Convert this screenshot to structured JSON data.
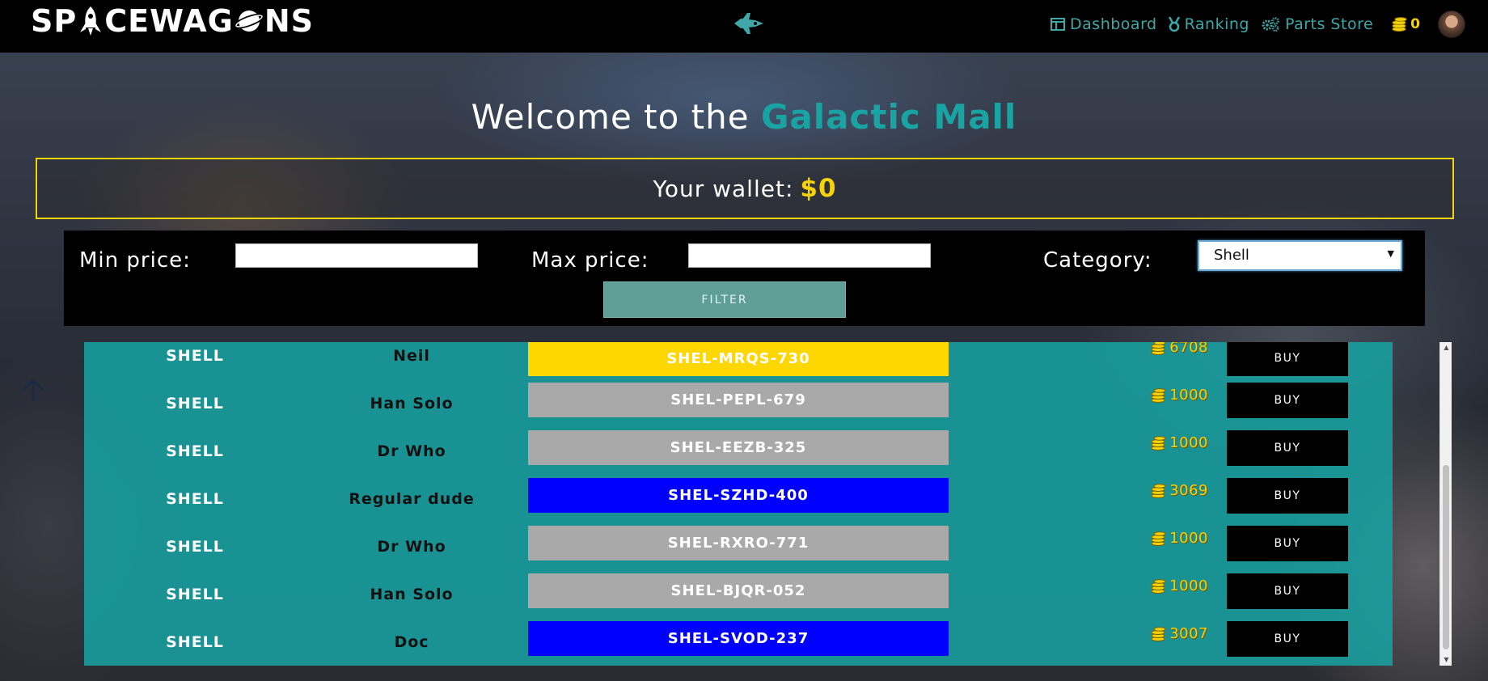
{
  "brand": {
    "logo_parts": [
      "SP",
      "CEWAG",
      "NS"
    ],
    "logo_glyphs": [
      "rocket-a-glyph",
      "planet-o-glyph"
    ]
  },
  "nav": {
    "center_icon": "spaceship-icon",
    "links": [
      {
        "label": "Dashboard",
        "icon": "dashboard-icon"
      },
      {
        "label": "Ranking",
        "icon": "medal-icon"
      },
      {
        "label": "Parts Store",
        "icon": "gears-icon"
      }
    ],
    "coins": "0",
    "colors": {
      "link": "#3fa7a7",
      "coins": "#f5d20a"
    }
  },
  "hero": {
    "welcome_prefix": "Welcome to the",
    "welcome_accent": "Galactic Mall",
    "wallet_label": "Your wallet:",
    "wallet_amount": "$0"
  },
  "filters": {
    "min_price_label": "Min price:",
    "min_price_value": "",
    "max_price_label": "Max price:",
    "max_price_value": "",
    "category_label": "Category:",
    "category_value": "Shell",
    "filter_button": "FILTER"
  },
  "parts": [
    {
      "category": "SHELL",
      "owner": "Neil",
      "code": "SHEL-MRQS-730",
      "rarity_color": "#ffd700",
      "price": "6708",
      "buy": "BUY"
    },
    {
      "category": "SHELL",
      "owner": "Han Solo",
      "code": "SHEL-PEPL-679",
      "rarity_color": "#a9a9a9",
      "price": "1000",
      "buy": "BUY"
    },
    {
      "category": "SHELL",
      "owner": "Dr Who",
      "code": "SHEL-EEZB-325",
      "rarity_color": "#a9a9a9",
      "price": "1000",
      "buy": "BUY"
    },
    {
      "category": "SHELL",
      "owner": "Regular dude",
      "code": "SHEL-SZHD-400",
      "rarity_color": "#0000ff",
      "price": "3069",
      "buy": "BUY"
    },
    {
      "category": "SHELL",
      "owner": "Dr Who",
      "code": "SHEL-RXRO-771",
      "rarity_color": "#a9a9a9",
      "price": "1000",
      "buy": "BUY"
    },
    {
      "category": "SHELL",
      "owner": "Han Solo",
      "code": "SHEL-BJQR-052",
      "rarity_color": "#a9a9a9",
      "price": "1000",
      "buy": "BUY"
    },
    {
      "category": "SHELL",
      "owner": "Doc",
      "code": "SHEL-SVOD-237",
      "rarity_color": "#0000ff",
      "price": "3007",
      "buy": "BUY"
    }
  ]
}
